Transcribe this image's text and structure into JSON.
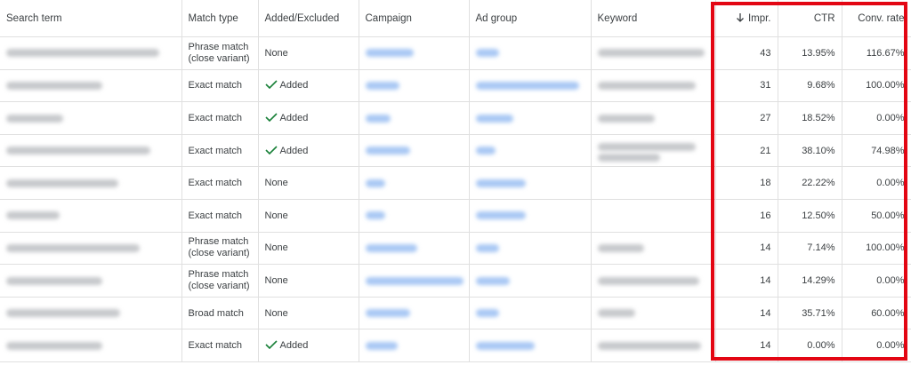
{
  "table": {
    "headers": {
      "search_term": "Search term",
      "match_type": "Match type",
      "added_excluded": "Added/Excluded",
      "campaign": "Campaign",
      "ad_group": "Ad group",
      "keyword": "Keyword",
      "impr": "Impr.",
      "ctr": "CTR",
      "conv_rate": "Conv. rate"
    },
    "sort_icon": "arrow-down-icon",
    "added_icon": "checkmark-icon",
    "accent_color": "#188038",
    "link_color": "#1a73e8",
    "highlight_color": "#e30613",
    "rows": [
      {
        "match": "Phrase match (close variant)",
        "status": "None",
        "impr": "43",
        "ctr": "13.95%",
        "conv": "116.67%"
      },
      {
        "match": "Exact match",
        "status": "Added",
        "impr": "31",
        "ctr": "9.68%",
        "conv": "100.00%"
      },
      {
        "match": "Exact match",
        "status": "Added",
        "impr": "27",
        "ctr": "18.52%",
        "conv": "0.00%"
      },
      {
        "match": "Exact match",
        "status": "Added",
        "impr": "21",
        "ctr": "38.10%",
        "conv": "74.98%"
      },
      {
        "match": "Exact match",
        "status": "None",
        "impr": "18",
        "ctr": "22.22%",
        "conv": "0.00%"
      },
      {
        "match": "Exact match",
        "status": "None",
        "impr": "16",
        "ctr": "12.50%",
        "conv": "50.00%"
      },
      {
        "match": "Phrase match (close variant)",
        "status": "None",
        "impr": "14",
        "ctr": "7.14%",
        "conv": "100.00%"
      },
      {
        "match": "Phrase match (close variant)",
        "status": "None",
        "impr": "14",
        "ctr": "14.29%",
        "conv": "0.00%"
      },
      {
        "match": "Broad match",
        "status": "None",
        "impr": "14",
        "ctr": "35.71%",
        "conv": "60.00%"
      },
      {
        "match": "Exact match",
        "status": "Added",
        "impr": "14",
        "ctr": "0.00%",
        "conv": "0.00%"
      }
    ]
  }
}
